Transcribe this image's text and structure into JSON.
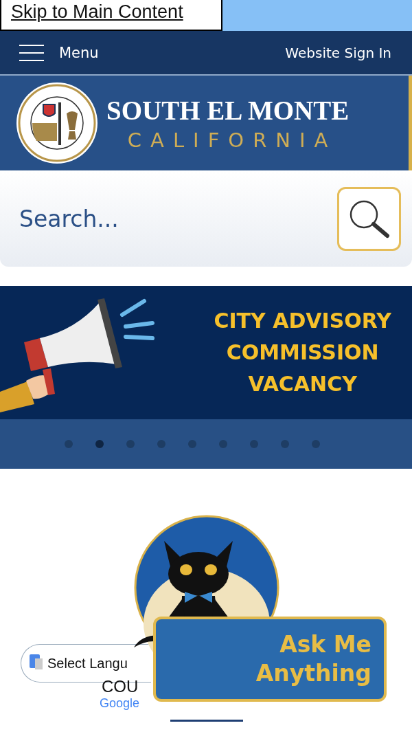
{
  "skip_link": "Skip to Main Content",
  "nav": {
    "menu_label": "Menu",
    "sign_in": "Website Sign In"
  },
  "header": {
    "title": "SOUTH EL MONTE",
    "subtitle": "CALIFORNIA"
  },
  "search": {
    "placeholder": "Search..."
  },
  "slider": {
    "lines": [
      "CITY ADVISORY",
      "COMMISSION",
      "VACANCY"
    ],
    "dots": [
      {
        "selected": false
      },
      {
        "selected": true
      },
      {
        "selected": false
      },
      {
        "selected": false
      },
      {
        "selected": false
      },
      {
        "selected": false
      },
      {
        "selected": false
      },
      {
        "selected": false
      },
      {
        "selected": false
      }
    ]
  },
  "translate": {
    "select_label": "Select Langu",
    "heading_fragment": "COU",
    "brand": "Google"
  },
  "chat_widget": {
    "lines": [
      "Ask Me",
      "Anything"
    ]
  }
}
